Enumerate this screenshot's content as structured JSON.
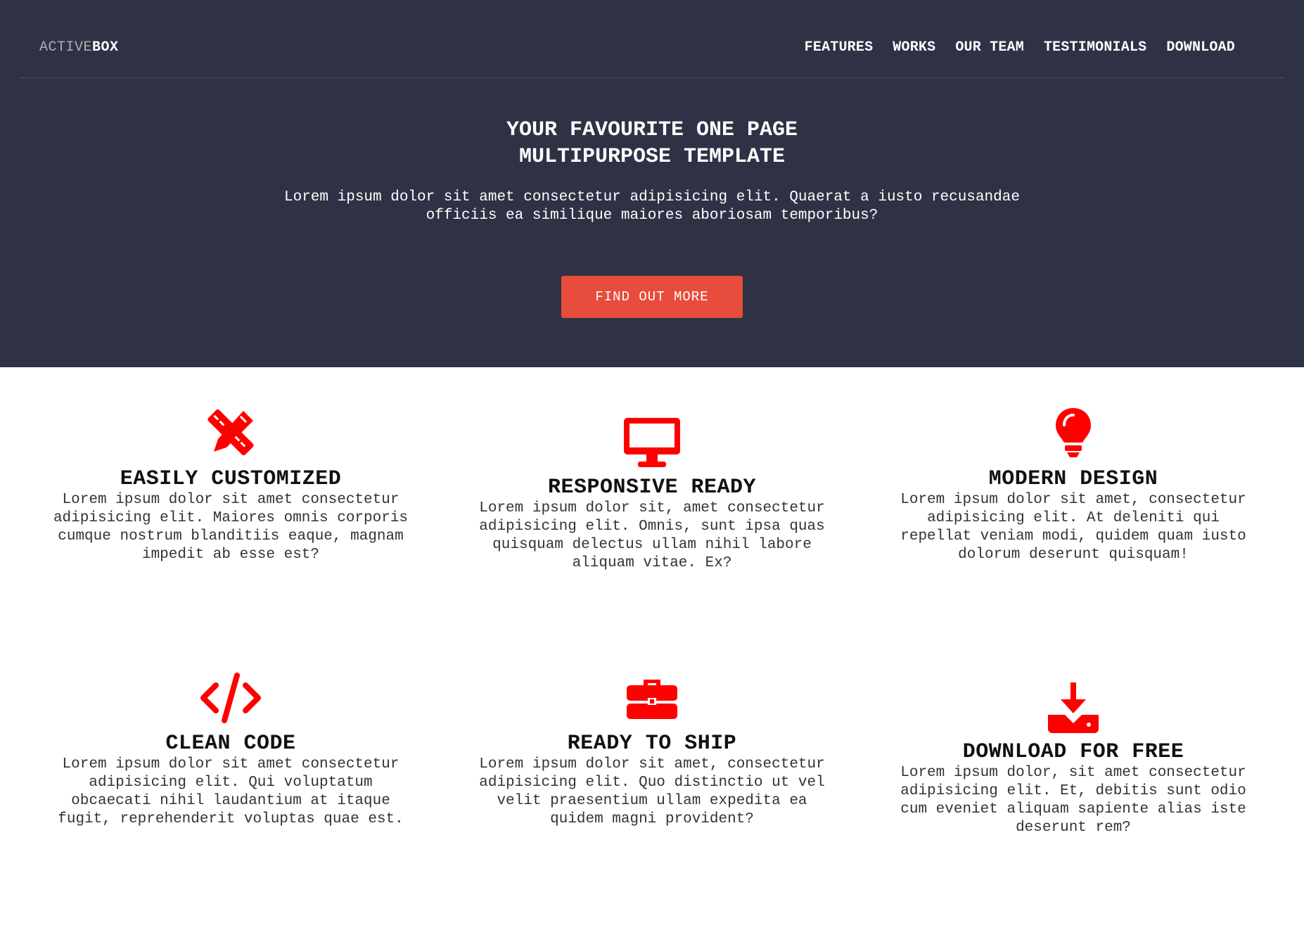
{
  "brand": {
    "part1": "ACTIVE",
    "part2": "BOX"
  },
  "nav": [
    "FEATURES",
    "WORKS",
    "OUR TEAM",
    "TESTIMONIALS",
    "DOWNLOAD"
  ],
  "hero": {
    "title_line1": "YOUR FAVOURITE ONE PAGE",
    "title_line2": "MULTIPURPOSE TEMPLATE",
    "subtitle": "Lorem ipsum dolor sit amet consectetur adipisicing elit. Quaerat a iusto recusandae officiis ea similique maiores aboriosam temporibus?",
    "cta": "FIND OUT MORE"
  },
  "colors": {
    "hero_bg": "#2e3244",
    "accent": "#e74c3c",
    "icon": "#ff0000"
  },
  "features": [
    {
      "icon": "pencil-ruler-icon",
      "title": "EASILY CUSTOMIZED",
      "text": "Lorem ipsum dolor sit amet consectetur adipisicing elit. Maiores omnis corporis cumque nostrum blanditiis eaque, magnam impedit ab esse est?"
    },
    {
      "icon": "desktop-icon",
      "title": "RESPONSIVE READY",
      "text": "Lorem ipsum dolor sit, amet consectetur adipisicing elit. Omnis, sunt ipsa quas quisquam delectus ullam nihil labore aliquam vitae. Ex?"
    },
    {
      "icon": "lightbulb-icon",
      "title": "MODERN DESIGN",
      "text": "Lorem ipsum dolor sit amet, consectetur adipisicing elit. At deleniti qui repellat veniam modi, quidem quam iusto dolorum deserunt quisquam!"
    },
    {
      "icon": "code-icon",
      "title": "CLEAN CODE",
      "text": "Lorem ipsum dolor sit amet consectetur adipisicing elit. Qui voluptatum obcaecati nihil laudantium at itaque fugit, reprehenderit voluptas quae est."
    },
    {
      "icon": "briefcase-icon",
      "title": "READY TO SHIP",
      "text": "Lorem ipsum dolor sit amet, consectetur adipisicing elit. Quo distinctio ut vel velit praesentium ullam expedita ea quidem magni provident?"
    },
    {
      "icon": "download-icon",
      "title": "DOWNLOAD FOR FREE",
      "text": "Lorem ipsum dolor, sit amet consectetur adipisicing elit. Et, debitis sunt odio cum eveniet aliquam sapiente alias iste deserunt rem?"
    }
  ]
}
